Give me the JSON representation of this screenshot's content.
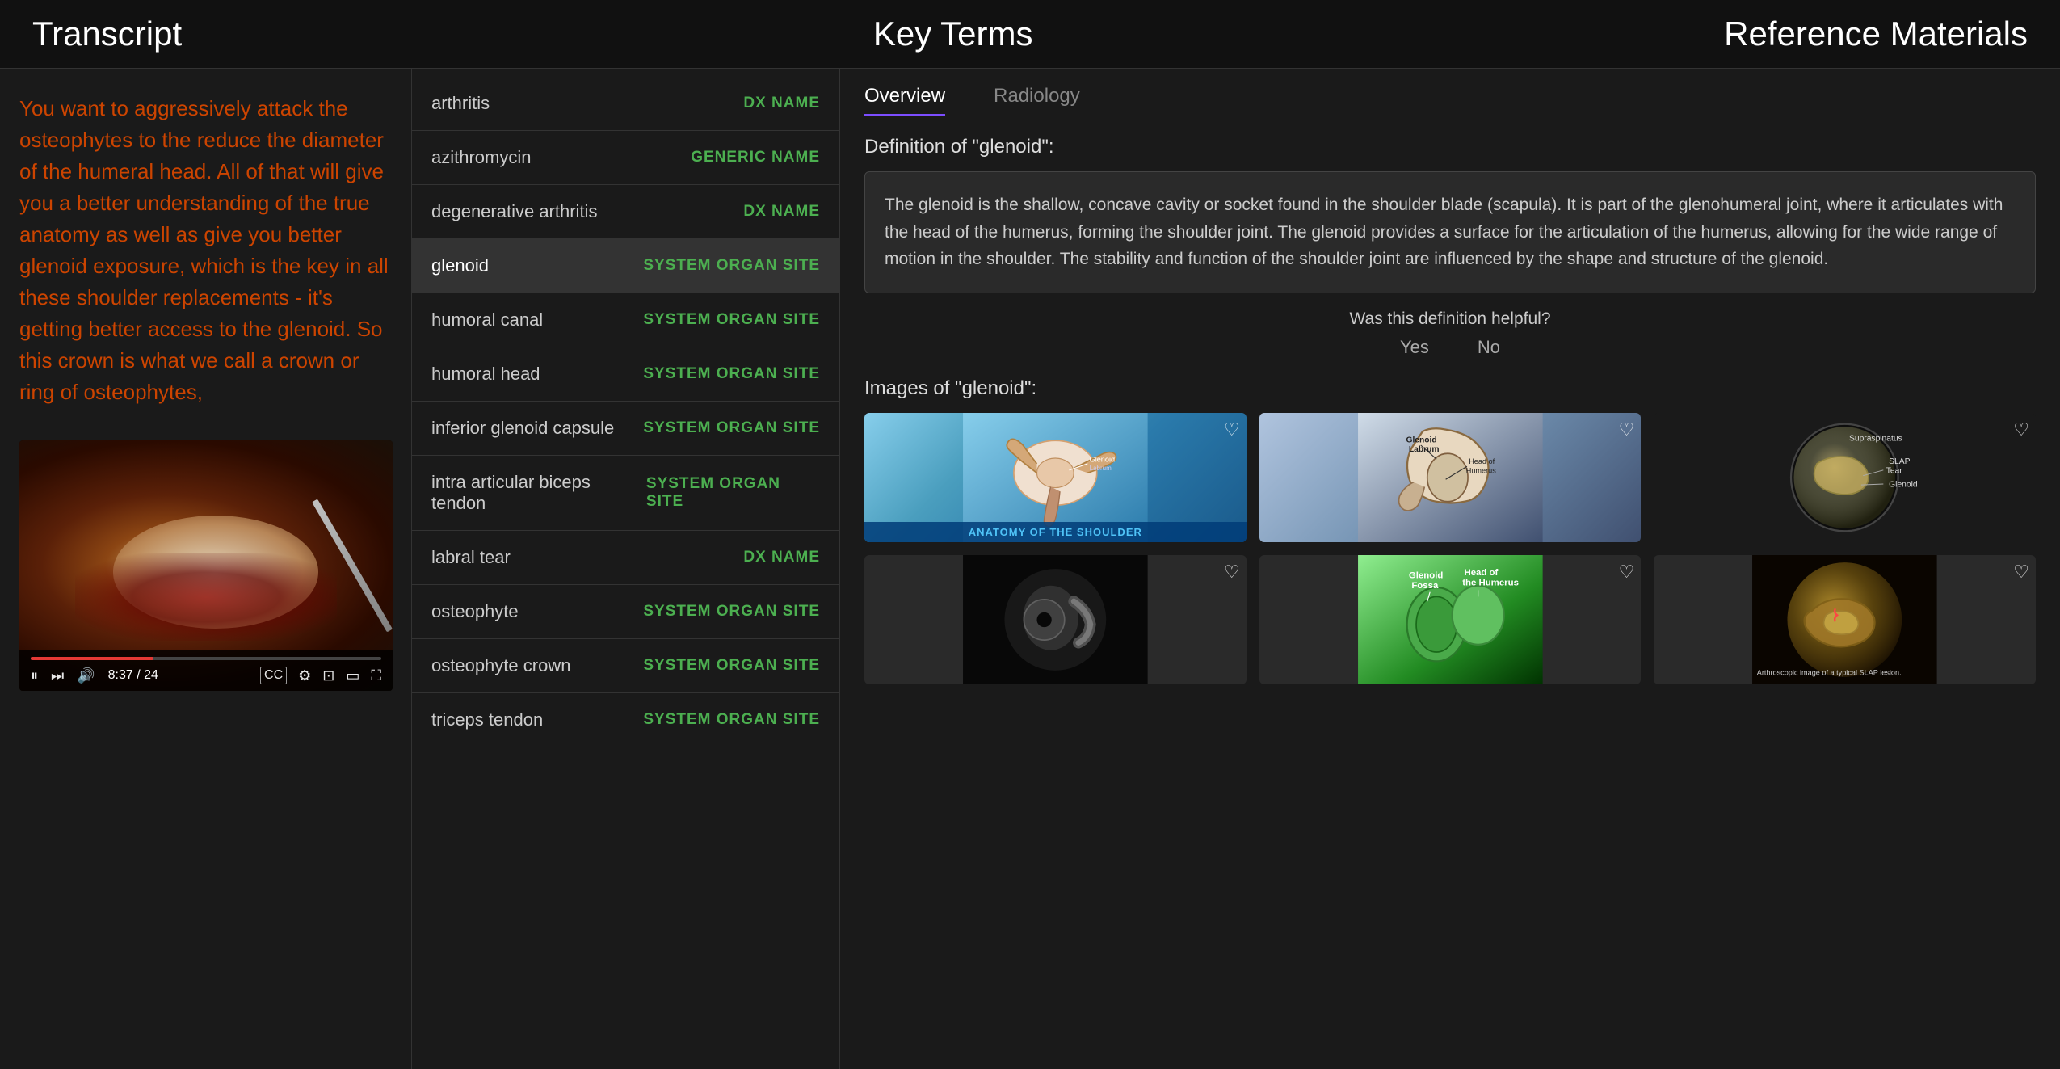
{
  "header": {
    "transcript_title": "Transcript",
    "key_terms_title": "Key Terms",
    "reference_title": "Reference Materials"
  },
  "transcript": {
    "text": "You want to aggressively attack the osteophytes to the reduce the diameter of the humeral head. All of that will give you a better understanding of the true anatomy as well as give you better glenoid exposure, which is the key in all these shoulder replacements - it's getting better access to the glenoid. So this crown is what we call a crown or ring of osteophytes,",
    "time_current": "8:37",
    "time_total": "24",
    "time_display": "8:37 / 24"
  },
  "key_terms": {
    "items": [
      {
        "name": "arthritis",
        "type": "DX NAME",
        "type_class": "type-dx",
        "active": false
      },
      {
        "name": "azithromycin",
        "type": "GENERIC NAME",
        "type_class": "type-generic",
        "active": false
      },
      {
        "name": "degenerative arthritis",
        "type": "DX NAME",
        "type_class": "type-dx",
        "active": false
      },
      {
        "name": "glenoid",
        "type": "SYSTEM ORGAN SITE",
        "type_class": "type-organ",
        "active": true
      },
      {
        "name": "humoral canal",
        "type": "SYSTEM ORGAN SITE",
        "type_class": "type-organ",
        "active": false
      },
      {
        "name": "humoral head",
        "type": "SYSTEM ORGAN SITE",
        "type_class": "type-organ",
        "active": false
      },
      {
        "name": "inferior glenoid capsule",
        "type": "SYSTEM ORGAN SITE",
        "type_class": "type-organ",
        "active": false
      },
      {
        "name": "intra articular biceps tendon",
        "type": "SYSTEM ORGAN SITE",
        "type_class": "type-organ",
        "active": false
      },
      {
        "name": "labral tear",
        "type": "DX NAME",
        "type_class": "type-dx",
        "active": false
      },
      {
        "name": "osteophyte",
        "type": "SYSTEM ORGAN SITE",
        "type_class": "type-organ",
        "active": false
      },
      {
        "name": "osteophyte crown",
        "type": "SYSTEM ORGAN SITE",
        "type_class": "type-organ",
        "active": false
      },
      {
        "name": "triceps tendon",
        "type": "SYSTEM ORGAN SITE",
        "type_class": "type-organ",
        "active": false
      }
    ]
  },
  "reference": {
    "tabs": [
      {
        "label": "Overview",
        "active": true
      },
      {
        "label": "Radiology",
        "active": false
      }
    ],
    "definition_label": "Definition of \"glenoid\":",
    "definition_text": "The glenoid is the shallow, concave cavity or socket found in the shoulder blade (scapula). It is part of the glenohumeral joint, where it articulates with the head of the humerus, forming the shoulder joint. The glenoid provides a surface for the articulation of the humerus, allowing for the wide range of motion in the shoulder. The stability and function of the shoulder joint are influenced by the shape and structure of the glenoid.",
    "helpful_question": "Was this definition helpful?",
    "helpful_yes": "Yes",
    "helpful_no": "No",
    "images_label": "Images of \"glenoid\":",
    "images": [
      {
        "id": "img1",
        "alt": "Anatomy of the Shoulder",
        "label": "ANATOMY OF THE SHOULDER",
        "style": "shoulder-anatomy"
      },
      {
        "id": "img2",
        "alt": "Glenoid Labrum diagram",
        "label": "",
        "style": "glenoid-diagram"
      },
      {
        "id": "img3",
        "alt": "SLAP Test arthroscopic",
        "label": "",
        "style": "circular-dark"
      },
      {
        "id": "img4",
        "alt": "MRI glenoid dark",
        "label": "",
        "style": "xray"
      },
      {
        "id": "img5",
        "alt": "Glenoid Fossa anatomy",
        "label": "",
        "style": "green-anatomy"
      },
      {
        "id": "img6",
        "alt": "Arthroscopic SLAP lesion",
        "label": "",
        "style": "arthroscopic"
      }
    ]
  },
  "colors": {
    "accent_green": "#4caf50",
    "accent_purple": "#7c4dff",
    "transcript_orange": "#cc4400",
    "bg_dark": "#1a1a1a",
    "bg_darker": "#111"
  },
  "icons": {
    "pause": "⏸",
    "next": "⏭",
    "volume": "🔊",
    "cc": "CC",
    "settings": "⚙",
    "pip": "⊡",
    "theater": "▭",
    "fullscreen": "⛶",
    "heart": "♡"
  }
}
